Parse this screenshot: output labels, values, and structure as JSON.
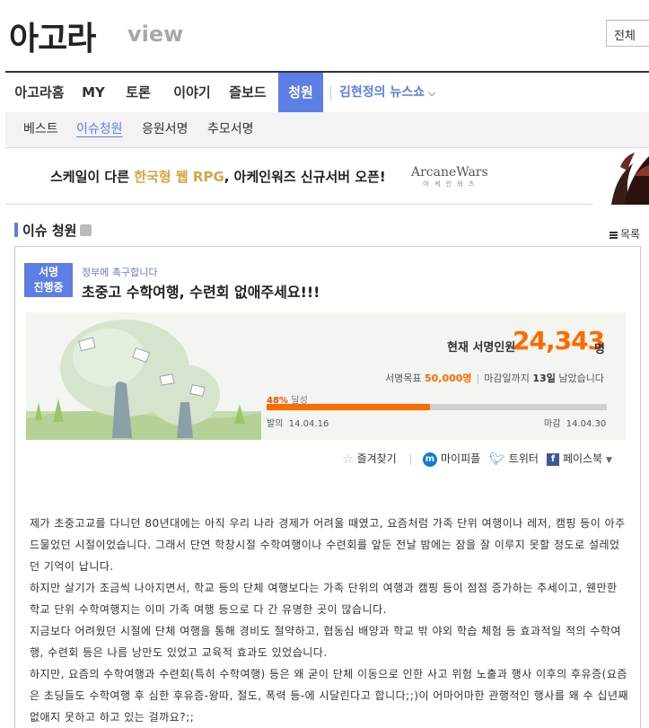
{
  "header": {
    "logo": "아고라",
    "logo_sub": "view",
    "scope_select": "전체"
  },
  "main_nav": {
    "items": [
      {
        "label": "아고라홈",
        "active": true
      },
      {
        "label": "MY",
        "active": false
      },
      {
        "label": "토론",
        "active": false
      },
      {
        "label": "이야기",
        "active": false
      },
      {
        "label": "즐보드",
        "active": false
      },
      {
        "label": "청원",
        "active": true
      }
    ],
    "special": "김현정의 뉴스쇼"
  },
  "sub_nav": {
    "items": [
      {
        "label": "베스트",
        "active": false
      },
      {
        "label": "이슈청원",
        "active": true
      },
      {
        "label": "응원서명",
        "active": false
      },
      {
        "label": "추모서명",
        "active": false
      }
    ]
  },
  "banner": {
    "text_pre": "스케일이 다른 ",
    "text_highlight": "한국형 웹 RPG",
    "text_post": ", 아케인워즈 신규서버 오픈!",
    "game_logo": "ArcaneWars",
    "game_logo_sub": "아 케 인 워 즈"
  },
  "section": {
    "title": "이슈 청원",
    "list_label": "목록"
  },
  "petition": {
    "badge_line1": "서명",
    "badge_line2": "진행중",
    "kicker": "정부에 촉구합니다",
    "title": "초중고 수학여행, 수련회 없애주세요!!!",
    "current_label": "현재 서명인원",
    "current_count": "24,343",
    "current_unit": "명",
    "goal_label": "서명목표",
    "goal_value": "50,000명",
    "deadline_pre": "마감일까지",
    "deadline_days": "13일",
    "deadline_post": "남았습니다",
    "progress_percent": "48%",
    "progress_fraction": 0.48,
    "progress_suffix": "달성",
    "start_label": "발의",
    "start_date": "14.04.16",
    "end_label": "마감",
    "end_date": "14.04.30"
  },
  "share": {
    "favorite": "즐겨찾기",
    "mypeople": "마이피플",
    "twitter": "트위터",
    "facebook": "페이스북"
  },
  "body": {
    "paragraphs": [
      "제가 초중고교를 다니던 80년대에는 아직 우리 나라 경제가 어려울 때였고, 요즘처럼 가족 단위 여행이나 레저, 캠핑 등이 아주 드물었던 시절이었습니다. 그래서 단연 학창시절 수학여행이나 수련회를 앞둔 전날 밤에는 잠을 잘 이루지 못할 정도로 설레었던 기억이 납니다.",
      "하지만 살기가 조금씩 나아지면서, 학교 등의 단체 여행보다는 가족 단위의 여행과 캠핑 등이 점점 증가하는 추세이고, 웬만한 학교 단위 수학여행지는 이미 가족 여행 등으로 다 간 유명한 곳이 많습니다.",
      "지금보다 어려웠던 시절에 단체 여행을 통해 경비도 절약하고, 협동심 배양과 학교 밖 야외 학습 체험 등 효과적일 적의 수학여행, 수련회 등은 나름 낭만도 있었고 교육적 효과도 있었습니다.",
      "하지만, 요즘의 수학여행과 수련회(특히 수학여행) 등은 왜 굳이 단체 이동으로 인한 사고 위험 노출과 행사 이후의 후유증(요즘은 초딩들도 수학여행 후 심한 후유증-왕따, 절도, 폭력 등-에 시달린다고 합니다;;)이 어마어마한 관행적인 행사를 왜 수 십년째 없애지 못하고 하고 있는 걸까요?;;"
    ]
  },
  "colors": {
    "accent": "#5c7ee6",
    "orange": "#ff6a00",
    "stats_bg": "#f2f5f0"
  }
}
